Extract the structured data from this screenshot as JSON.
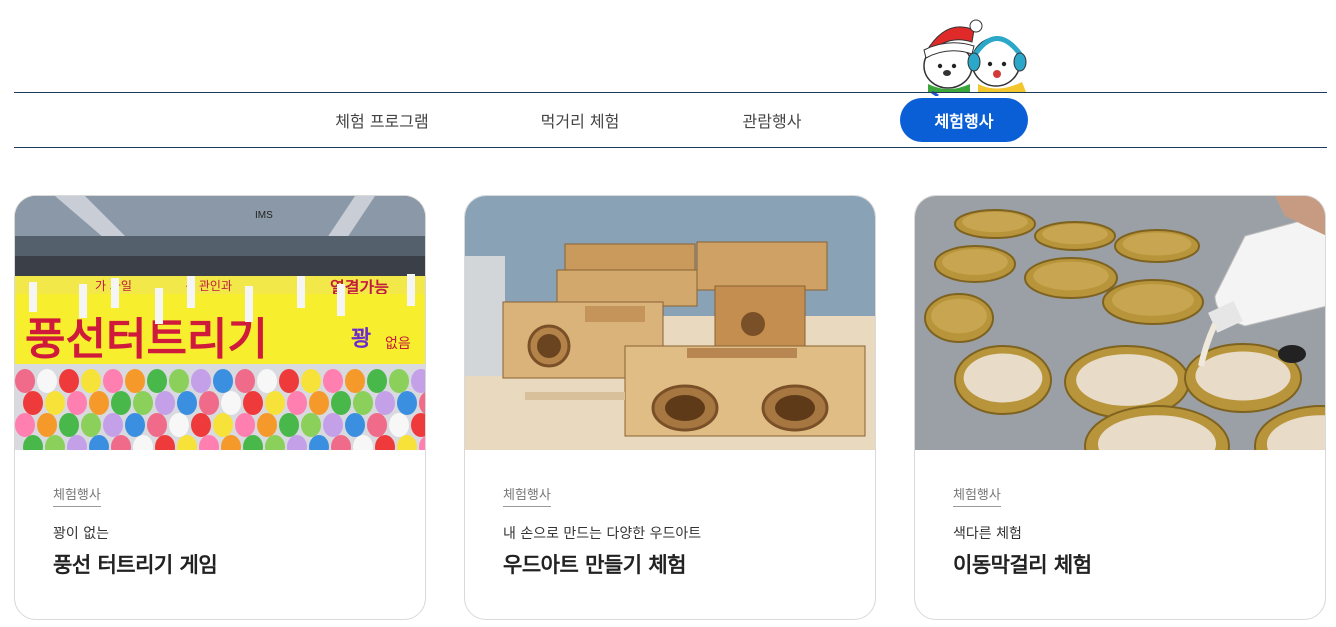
{
  "tabs": [
    {
      "label": "체험 프로그램",
      "active": false
    },
    {
      "label": "먹거리 체험",
      "active": false
    },
    {
      "label": "관람행사",
      "active": false
    },
    {
      "label": "체험행사",
      "active": true
    }
  ],
  "cards": [
    {
      "category": "체험행사",
      "subtitle": "꽝이 없는",
      "title": "풍선 터트리기 게임",
      "photo_text": {
        "banner": "풍선터트리기",
        "badge": "꽝",
        "top_left": "가 과일",
        "top_mid": "~ 관인과",
        "top_right": "열결가능",
        "right_small": "없음",
        "brand": "IMS"
      }
    },
    {
      "category": "체험행사",
      "subtitle": "내 손으로 만드는 다양한 우드아트",
      "title": "우드아트 만들기 체험"
    },
    {
      "category": "체험행사",
      "subtitle": "색다른 체험",
      "title": "이동막걸리 체험"
    }
  ],
  "colors": {
    "accent": "#0b5fd6",
    "rule": "#1f3b57"
  }
}
